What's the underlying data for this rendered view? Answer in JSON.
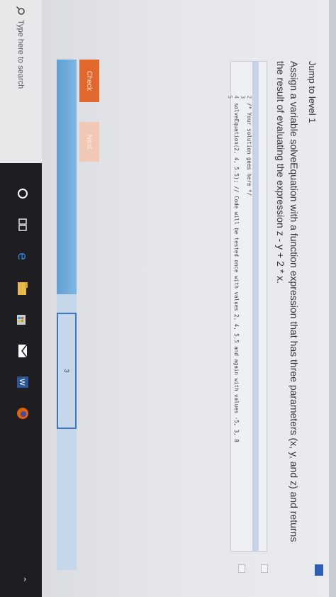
{
  "app": {
    "jump_link": "Jump to level 1",
    "prompt": "Assign a variable solveEquation with a function expression that has three parameters (x, y, and z) and returns the result of evaluating the expression z - y + 2 * x."
  },
  "editor": {
    "lines": [
      {
        "num": "1",
        "code": ""
      },
      {
        "num": "2",
        "code": "/* Your solution goes here */"
      },
      {
        "num": "3",
        "code": ""
      },
      {
        "num": "4",
        "code": "solveEquation(2, 4, 5.5); // Code will be tested once with values 2, 4, 5.5 and again with values -5, 3, 8"
      },
      {
        "num": "5",
        "code": ""
      }
    ]
  },
  "buttons": {
    "check": "Check",
    "next": "Next"
  },
  "progress": {
    "current_level": "3",
    "fill_fraction": 0.46
  },
  "taskbar": {
    "search_placeholder": "Type here to search",
    "icons": [
      "cortana-icon",
      "task-view-icon",
      "edge-icon",
      "file-explorer-icon",
      "store-icon",
      "mail-icon",
      "word-icon",
      "firefox-icon"
    ]
  },
  "colors": {
    "check_button": "#e2672c",
    "next_button": "#f1c8b4",
    "progress_fill": "#6aa8d8",
    "level_box_border": "#3a79c2",
    "taskbar": "#1d1d22"
  }
}
